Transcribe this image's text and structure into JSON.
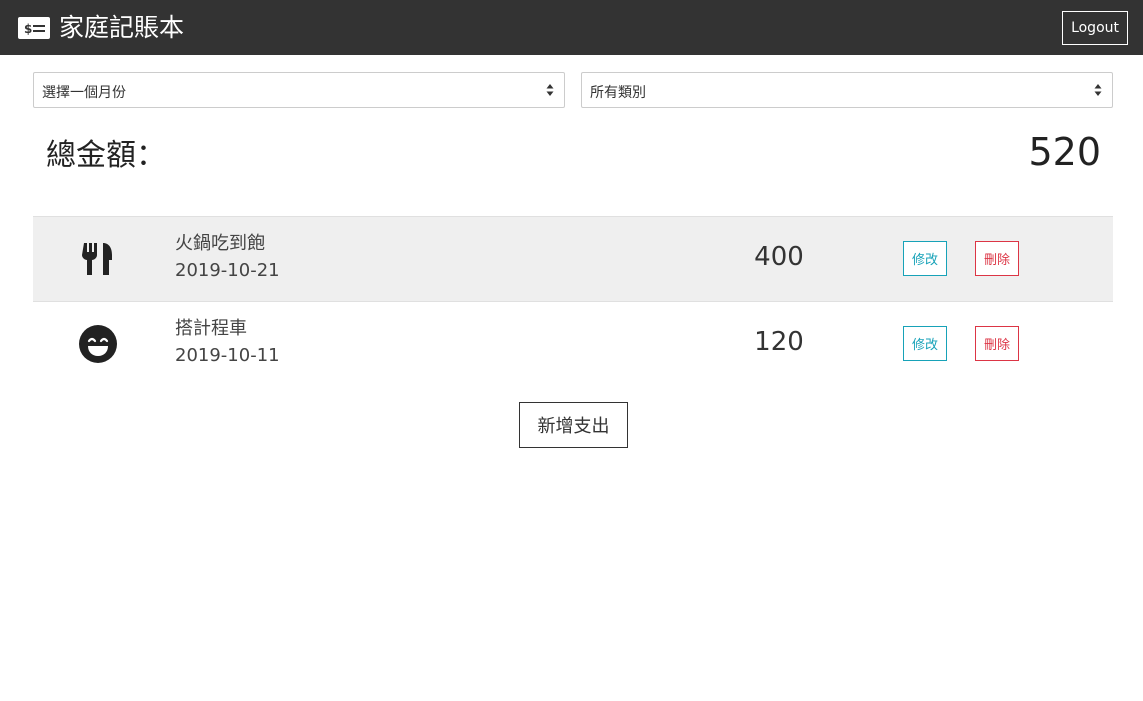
{
  "header": {
    "title": "家庭記賬本",
    "logout_label": "Logout",
    "icon": "money-bill-icon"
  },
  "filters": {
    "month_select": "選擇一個月份",
    "category_select": "所有類別"
  },
  "summary": {
    "total_label": "總金額：",
    "total_value": "520"
  },
  "records": [
    {
      "icon": "utensils-icon",
      "name": "火鍋吃到飽",
      "date": "2019-10-21",
      "amount": "400",
      "edit_label": "修改",
      "delete_label": "刪除"
    },
    {
      "icon": "smile-icon",
      "name": "搭計程車",
      "date": "2019-10-11",
      "amount": "120",
      "edit_label": "修改",
      "delete_label": "刪除"
    }
  ],
  "actions": {
    "add_label": "新增支出"
  },
  "colors": {
    "navbar": "#333333",
    "edit": "#17a2b8",
    "delete": "#dc3545",
    "alt_row": "#efefef"
  }
}
